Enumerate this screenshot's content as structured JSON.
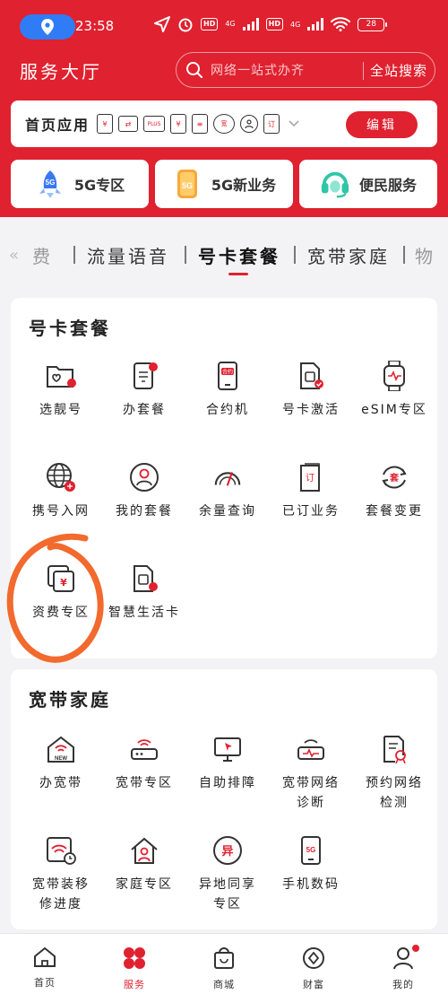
{
  "status": {
    "time": "23:58",
    "battery": "28",
    "net1": "4G",
    "net2": "4G",
    "hd": "HD"
  },
  "header": {
    "title": "服务大厅",
    "search_placeholder": "网络一站式办齐",
    "search_button": "全站搜索"
  },
  "apps_bar": {
    "label": "首页应用",
    "edit": "编辑",
    "mini_icons": [
      "yuan-card-icon",
      "transfer-folder-icon",
      "plus-crown-icon",
      "yuan-wallet-icon",
      "bill-list-icon",
      "broadband-icon",
      "profile-icon",
      "order-icon"
    ],
    "mini_texts": [
      "¥",
      "⇄",
      "PLUS",
      "¥",
      "≡",
      "宽",
      "",
      "订"
    ]
  },
  "quick": [
    {
      "label": "5G专区",
      "badge": "5G"
    },
    {
      "label": "5G新业务",
      "badge": "5G"
    },
    {
      "label": "便民服务"
    }
  ],
  "tabs": [
    "费",
    "流量语音",
    "号卡套餐",
    "宽带家庭",
    "物"
  ],
  "sections": [
    {
      "title": "号卡套餐",
      "items": [
        {
          "label": "选靓号"
        },
        {
          "label": "办套餐"
        },
        {
          "label": "合约机",
          "badge": "合约"
        },
        {
          "label": "号卡激活"
        },
        {
          "label": "eSIM专区"
        },
        {
          "label": "携号入网"
        },
        {
          "label": "我的套餐"
        },
        {
          "label": "余量查询"
        },
        {
          "label": "已订业务",
          "badge": "订"
        },
        {
          "label": "套餐变更",
          "badge": "套"
        },
        {
          "label": "资费专区",
          "badge": "¥"
        },
        {
          "label": "智慧生活卡"
        }
      ]
    },
    {
      "title": "宽带家庭",
      "items": [
        {
          "label": "办宽带",
          "badge": "NEW"
        },
        {
          "label": "宽带专区"
        },
        {
          "label": "自助排障"
        },
        {
          "label": "宽带网络诊断",
          "line1": "宽带网络",
          "line2": "诊断"
        },
        {
          "label": "预约网络检测",
          "line1": "预约网络",
          "line2": "检测"
        },
        {
          "label": "宽带装移修进度",
          "line1": "宽带装移",
          "line2": "修进度"
        },
        {
          "label": "家庭专区"
        },
        {
          "label": "异地同享专区",
          "line1": "异地同享",
          "line2": "专区",
          "badge": "异"
        },
        {
          "label": "手机数码",
          "badge": "5G"
        }
      ]
    }
  ],
  "nav": [
    {
      "label": "首页"
    },
    {
      "label": "服务"
    },
    {
      "label": "商城"
    },
    {
      "label": "财富"
    },
    {
      "label": "我的"
    }
  ],
  "colors": {
    "brand": "#e0212f",
    "annotation": "#f26a2e",
    "location_pill": "#2f7cf6"
  }
}
